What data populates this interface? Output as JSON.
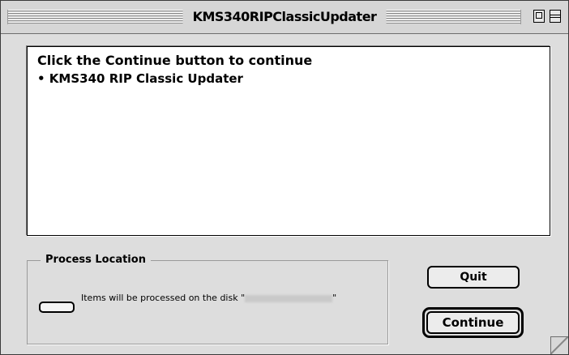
{
  "window": {
    "title": "KMS340RIPClassicUpdater"
  },
  "content": {
    "instruction": "Click the Continue button to continue",
    "item": "• KMS340 RIP Classic Updater"
  },
  "process_location": {
    "legend": "Process Location",
    "message": "Items will be processed on the disk \"",
    "message_end": "\""
  },
  "buttons": {
    "quit_label": "Quit",
    "continue_label": "Continue"
  },
  "icons": {
    "zoom": "zoom-box-icon",
    "collapse": "collapse-box-icon",
    "disk": "disk-icon",
    "grow": "resize-grip-icon"
  }
}
